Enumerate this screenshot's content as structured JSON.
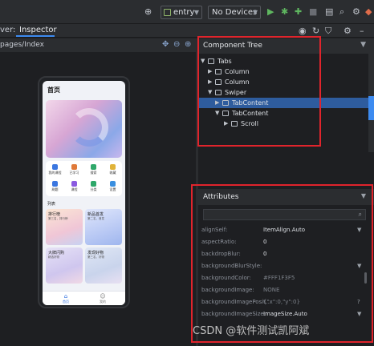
{
  "toolbar": {
    "module": "entry",
    "device": "No Devices",
    "icons": [
      "target-icon",
      "run-icon",
      "debug-icon",
      "profile-icon",
      "stop-icon",
      "device-manager-icon",
      "search-icon",
      "settings-icon",
      "logo-icon"
    ]
  },
  "tabs": {
    "prev_tab_fragment": "ver:",
    "active_tab": "Inspector"
  },
  "left": {
    "path": "pages/Index"
  },
  "phone": {
    "title": "首页",
    "grid": [
      "我的课程",
      "已学习",
      "搜索",
      "收藏",
      "刷题",
      "课程",
      "分类",
      "设置"
    ],
    "list_title": "列表",
    "cards": [
      {
        "title": "排行榜",
        "subtitle": "第三名，排行榜"
      },
      {
        "title": "新品首发",
        "subtitle": "第二名，首发"
      },
      {
        "title": "大牌闪购",
        "subtitle": "精选好物"
      },
      {
        "title": "发现好物",
        "subtitle": "第三名，好物"
      }
    ],
    "nav": [
      {
        "label": "首页",
        "icon": "home-icon"
      },
      {
        "label": "我的",
        "icon": "user-icon"
      }
    ]
  },
  "component_tree": {
    "title": "Component Tree",
    "nodes": [
      {
        "label": "Tabs",
        "arrow": "▼"
      },
      {
        "label": "Column",
        "arrow": "▶"
      },
      {
        "label": "Column",
        "arrow": "▶"
      },
      {
        "label": "Swiper",
        "arrow": "▼"
      },
      {
        "label": "TabContent",
        "arrow": "▶"
      },
      {
        "label": "TabContent",
        "arrow": "▼"
      },
      {
        "label": "Scroll",
        "arrow": "▶"
      }
    ]
  },
  "attributes": {
    "title": "Attributes",
    "rows": [
      {
        "key": "alignSelf:",
        "value": "ItemAlign.Auto",
        "dropdown": true
      },
      {
        "key": "aspectRatio:",
        "value": "0",
        "dropdown": false
      },
      {
        "key": "backdropBlur:",
        "value": "0",
        "dropdown": false
      },
      {
        "key": "backgroundBlurStyle:",
        "value": "",
        "dropdown": true
      },
      {
        "key": "backgroundColor:",
        "value": "#FFF1F3F5",
        "dropdown": false
      },
      {
        "key": "backgroundImage:",
        "value": "NONE",
        "dropdown": false
      },
      {
        "key": "backgroundImagePosit...",
        "value": "{\"x\":0,\"y\":0}",
        "dropdown": false
      },
      {
        "key": "backgroundImageSize:",
        "value": "ImageSize.Auto",
        "dropdown": true
      }
    ]
  },
  "watermark": "CSDN @软件测试凯阿斌",
  "colors": {
    "highlight_box": "#e0242c",
    "selection": "#2e5c9e",
    "accent": "#3d8bf0"
  }
}
